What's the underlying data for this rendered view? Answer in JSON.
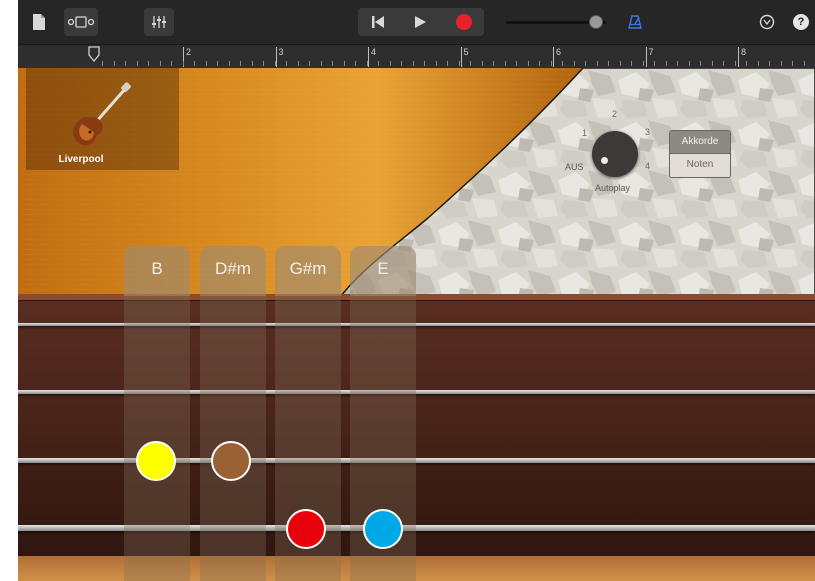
{
  "toolbar": {
    "icons": [
      "document-icon",
      "tracks-view-icon",
      "mixer-icon",
      "rewind-icon",
      "play-icon",
      "record-icon",
      "metronome-icon",
      "settings-icon",
      "help-icon"
    ],
    "help_label": "?",
    "volume_level": 0.9,
    "record_color": "#e8212a",
    "metronome_color": "#3b7be0"
  },
  "ruler": {
    "bars": [
      "2",
      "3",
      "4",
      "5",
      "6",
      "7",
      "8"
    ]
  },
  "instrument": {
    "name": "Liverpool"
  },
  "autoplay": {
    "label": "Autoplay",
    "off_label": "AUS",
    "positions": [
      "1",
      "2",
      "3",
      "4"
    ],
    "selected": "AUS"
  },
  "mode_switch": {
    "options": [
      "Akkorde",
      "Noten"
    ],
    "selected": "Akkorde"
  },
  "chords": [
    "B",
    "D#m",
    "G#m",
    "E"
  ],
  "strings": 4,
  "markers": [
    {
      "color": "#ffff00",
      "chord": "B",
      "string": 3
    },
    {
      "color": "#9a6234",
      "chord": "D#m",
      "string": 3
    },
    {
      "color": "#e8000a",
      "chord": "G#m",
      "string": 4
    },
    {
      "color": "#00a8e8",
      "chord": "E",
      "string": 4
    }
  ]
}
